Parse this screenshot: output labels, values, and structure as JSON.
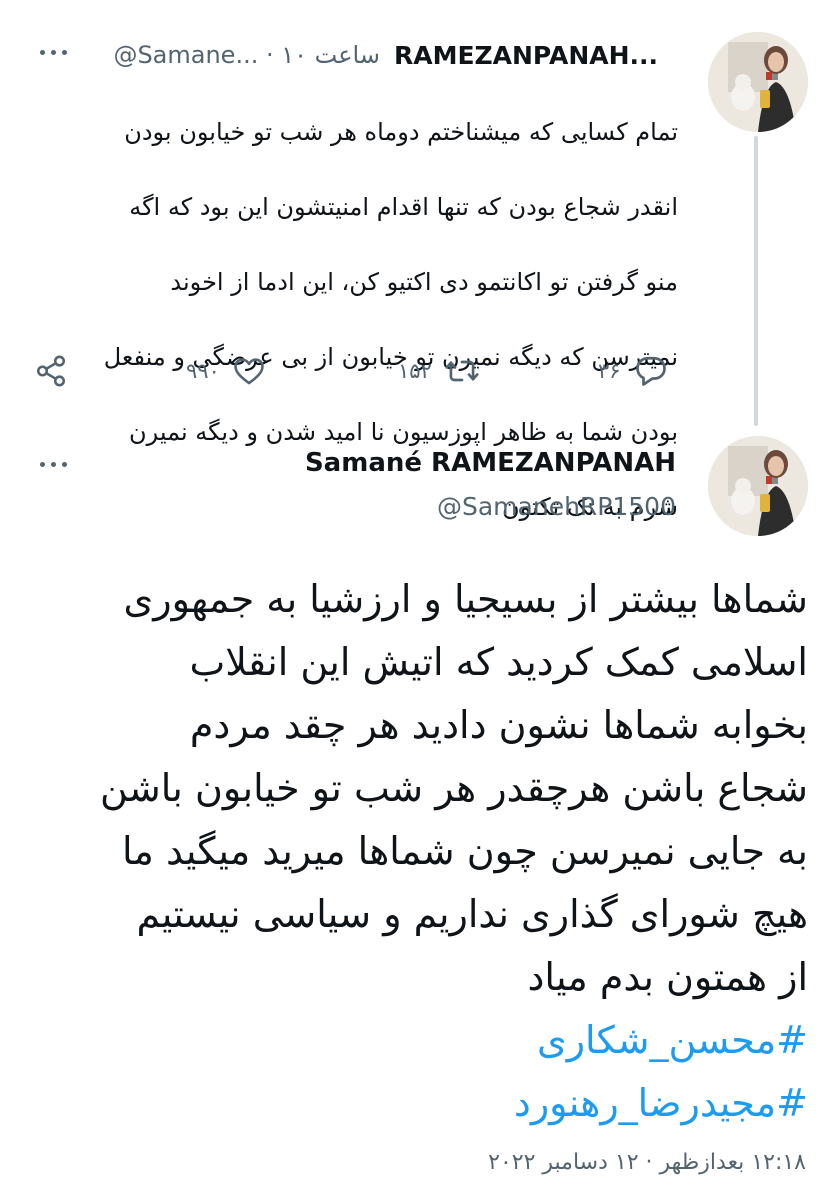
{
  "tweet1": {
    "display_name": "RAMEZANPANAH...",
    "handle": "@Samane...",
    "time_ago": "۱۰ ساعت",
    "separator": "·",
    "text_lines": [
      "تمام کسایی که میشناختم دوماه هر شب تو خیابون بودن",
      "انقدر شجاع بودن که تنها اقدام امنیتشون این بود که اگه",
      "منو گرفتن تو اکانتمو دی اکتیو کن، این ادما از اخوند",
      "نمیترسن که دیگه نمیرن تو خیابون از بی عرضگی و منفعل",
      "بودن شما به ظاهر اپوزسیون نا امید شدن  و دیگه نمیرن",
      "شرم به تک تکتون"
    ],
    "replies": "۳۶",
    "retweets": "۱۵۲",
    "likes": "۹۹۰"
  },
  "tweet2": {
    "display_name": "Samané RAMEZANPANAH",
    "handle": "@SamanehRP1500",
    "text_lines": [
      "شماها بیشتر از بسیجیا و ارزشیا به جمهوری",
      "اسلامی کمک کردید که اتیش این انقلاب",
      "بخوابه شماها نشون دادید هر چقد مردم",
      "شجاع باشن هرچقدر هر شب تو خیابون باشن",
      "به جایی نمیرسن چون شماها میرید میگید ما",
      "هیچ شورای گذاری نداریم  و سیاسی نیستیم",
      "از همتون بدم میاد"
    ],
    "hashtags": [
      "#محسن_شکاری",
      "#مجیدرضا_رهنورد"
    ],
    "timestamp": "۱۲:۱۸ بعدازظهر · ۱۲ دسامبر ۲۰۲۲"
  },
  "icons": {
    "more": "more-horizontal-icon",
    "reply": "reply-icon",
    "retweet": "retweet-icon",
    "like": "heart-icon",
    "share": "share-icon"
  },
  "colors": {
    "text": "#0f1419",
    "secondary": "#536471",
    "hashtag": "#1d9bf0",
    "thread_line": "#cfd9de"
  }
}
